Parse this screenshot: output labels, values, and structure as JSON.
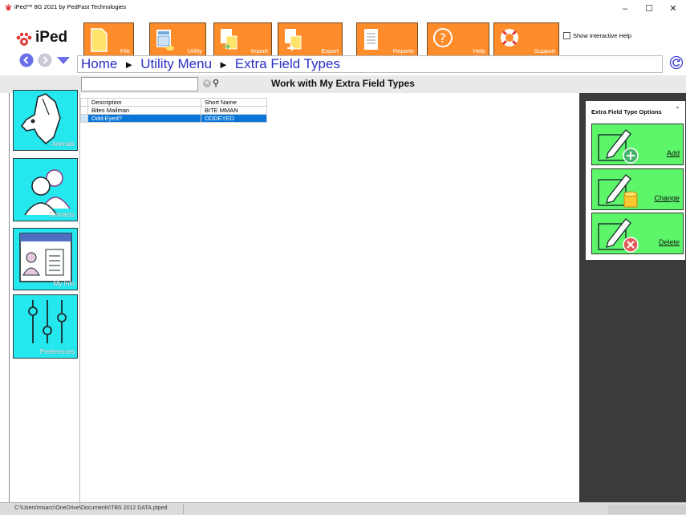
{
  "window": {
    "title": "iPed™ 8G 2021 by PedFast Technologies",
    "minimize_glyph": "–",
    "maximize_glyph": "☐",
    "close_glyph": "✕"
  },
  "toolbar": {
    "logo_text": "iPed",
    "buttons": [
      {
        "label": "File",
        "icon": "file-icon"
      },
      {
        "label": "Utility",
        "icon": "utility-icon"
      },
      {
        "label": "Import",
        "icon": "import-icon"
      },
      {
        "label": "Export",
        "icon": "export-icon"
      },
      {
        "label": "Reports",
        "icon": "reports-icon"
      },
      {
        "label": "Help",
        "icon": "help-icon"
      },
      {
        "label": "Support",
        "icon": "support-icon"
      }
    ],
    "show_help_label": "Show Interactive Help"
  },
  "breadcrumb": {
    "items": [
      "Home",
      "Utility Menu",
      "Extra Field Types"
    ],
    "separator": "►"
  },
  "search": {
    "placeholder": "",
    "value": ""
  },
  "page_title": "Work with My Extra Field Types",
  "sidebar": {
    "items": [
      {
        "label": "Animals",
        "icon": "dog-icon"
      },
      {
        "label": "Contacts",
        "icon": "contacts-icon"
      },
      {
        "label": "My Info",
        "icon": "my-info-icon"
      },
      {
        "label": "Preferences",
        "icon": "preferences-icon"
      }
    ]
  },
  "table": {
    "columns": [
      "Description",
      "Short Name"
    ],
    "rows": [
      {
        "description": "Bites Mailman",
        "short_name": "BITE MMAN",
        "selected": false
      },
      {
        "description": "Odd-Eyed?",
        "short_name": "ODDEYED",
        "selected": true
      }
    ]
  },
  "options_panel": {
    "title": "Extra Field Type Options",
    "buttons": [
      {
        "label": "Add"
      },
      {
        "label": "Change"
      },
      {
        "label": "Delete"
      }
    ]
  },
  "status_bar": {
    "path": "C:\\Users\\msacc\\OneDrive\\Documents\\TBS 2012 DATA.ptped"
  },
  "colors": {
    "toolbar_orange": "#ff8c2a",
    "sidebar_cyan": "#25e8ee",
    "option_green": "#5df56a",
    "selection_blue": "#0a76d8",
    "breadcrumb_blue": "#2a2fc4"
  }
}
